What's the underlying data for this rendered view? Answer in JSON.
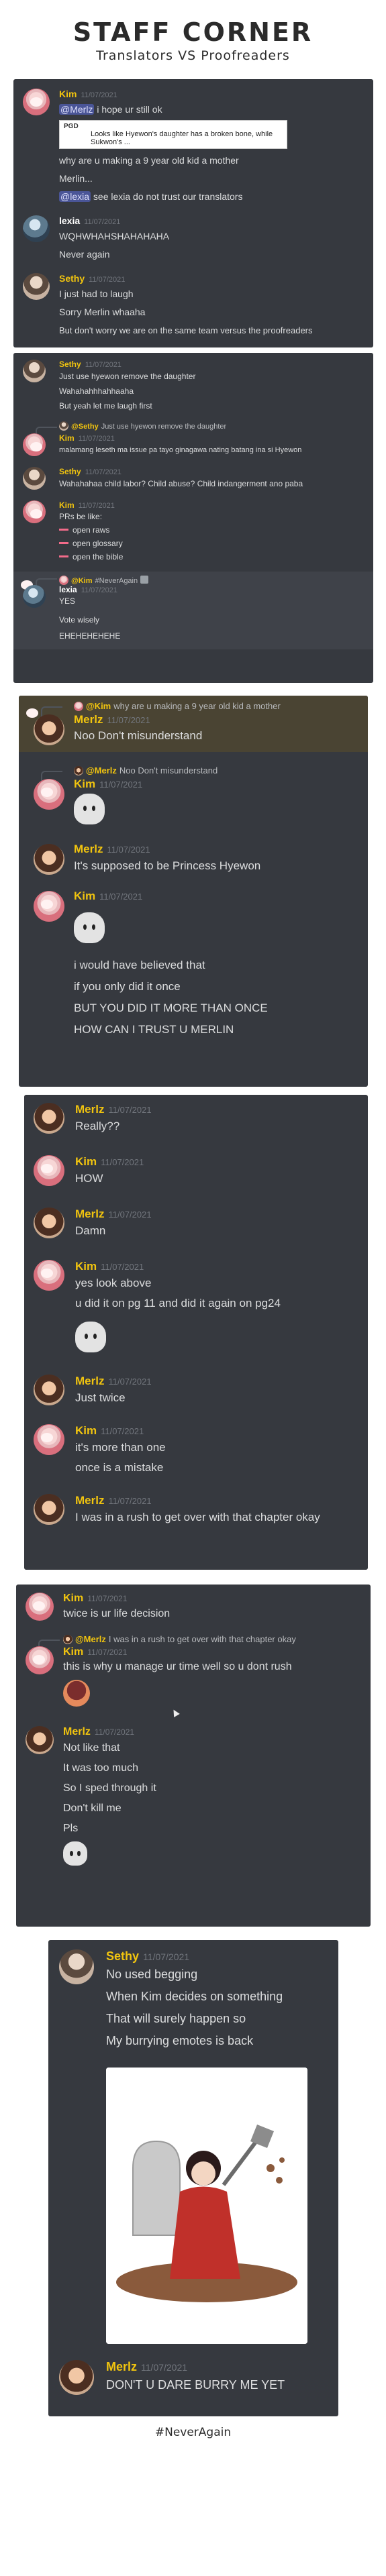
{
  "header": {
    "title": "STAFF CORNER",
    "subtitle": "Translators VS Proofreaders"
  },
  "users": {
    "kim": "Kim",
    "lexia": "lexia",
    "sethy": "Sethy",
    "merlz": "Merlz"
  },
  "panel1": {
    "m1": {
      "ts": "11/07/2021",
      "mention": "@Merlz",
      "l1": " i hope ur still ok",
      "embed_tag": "PGD",
      "embed_text": "Looks like Hyewon's daughter has a broken bone, while Sukwon's ...",
      "l2": "why are u making a 9 year old kid a mother",
      "l3": "Merlin...",
      "mention2": "@lexia",
      "l4": " see lexia do not trust our translators"
    },
    "m2": {
      "ts": "11/07/2021",
      "l1": "WQHWHAHSHAHAHAHA",
      "l2": "Never again"
    },
    "m3": {
      "ts": "11/07/2021",
      "l1": "I just had to laugh",
      "l2": "Sorry Merlin whaaha",
      "l3": "But don't worry we are on the same team versus the proofreaders"
    }
  },
  "panel2": {
    "m1": {
      "ts": "11/07/2021",
      "l1": "Just use hyewon remove the daughter",
      "l2": "Wahahahhhahhaaha",
      "l3": "But yeah let me laugh first"
    },
    "m2": {
      "reply_name": "@Sethy",
      "reply_text": "Just use hyewon remove the daughter",
      "ts": "11/07/2021",
      "l1": "malamang leseth ma issue pa tayo ginagawa nating batang ina si Hyewon"
    },
    "m3": {
      "ts": "11/07/2021",
      "l1": "Wahahahaa child labor? Child abuse? Child indangerment ano paba"
    },
    "m4": {
      "ts": "11/07/2021",
      "l1": "PRs be like:",
      "b1": "open raws",
      "b2": "open glossary",
      "b3": "open the bible"
    },
    "m5": {
      "reply_name": "@Kim",
      "reply_text": "#NeverAgain",
      "ts": "11/07/2021",
      "l1": "YES",
      "l2": "Vote wisely",
      "l3": "EHEHEHEHEHE"
    }
  },
  "panel3": {
    "r1": {
      "reply_name": "@Kim",
      "reply_text": "why are u making a 9 year old kid a mother"
    },
    "m1": {
      "ts": "11/07/2021",
      "l1": "Noo Don't misunderstand"
    },
    "r2": {
      "reply_name": "@Merlz",
      "reply_text": "Noo Don't misunderstand"
    },
    "m2": {
      "ts": "11/07/2021"
    },
    "m3": {
      "ts": "11/07/2021",
      "l1": "It's supposed to be Princess Hyewon"
    },
    "m4": {
      "ts": "11/07/2021",
      "l1": "i would have believed that",
      "l2": "if you only did it once",
      "l3": "BUT YOU DID IT MORE THAN ONCE",
      "l4": "HOW CAN I TRUST U MERLIN"
    }
  },
  "panel4": {
    "m1": {
      "ts": "11/07/2021",
      "l1": "Really??"
    },
    "m2": {
      "ts": "11/07/2021",
      "l1": "HOW"
    },
    "m3": {
      "ts": "11/07/2021",
      "l1": "Damn"
    },
    "m4": {
      "ts": "11/07/2021",
      "l1": "yes look above",
      "l2": "u did it on pg 11 and did it again on pg24"
    },
    "m5": {
      "ts": "11/07/2021",
      "l1": "Just twice"
    },
    "m6": {
      "ts": "11/07/2021",
      "l1": "it's more than one",
      "l2": "once is a mistake"
    },
    "m7": {
      "ts": "11/07/2021",
      "l1": "I was in a rush to get over with that chapter okay"
    }
  },
  "panel5": {
    "m1": {
      "ts": "11/07/2021",
      "l1": "twice is ur life decision"
    },
    "r1": {
      "reply_name": "@Merlz",
      "reply_text": "I was in a rush to get over with that chapter okay"
    },
    "m2": {
      "ts": "11/07/2021",
      "l1": "this is why u manage ur time well so u dont rush"
    },
    "m3": {
      "ts": "11/07/2021",
      "l1": "Not like that",
      "l2": "It was too much",
      "l3": "So I sped through it",
      "l4": "Don't kill me",
      "l5": "Pls"
    }
  },
  "panel6": {
    "m1": {
      "ts": "11/07/2021",
      "l1": "No used begging",
      "l2": "When Kim decides on something",
      "l3": "That will surely happen so",
      "l4": "My burrying emotes is back"
    },
    "m2": {
      "ts": "11/07/2021",
      "l1": "DON'T U DARE BURRY ME YET"
    }
  },
  "footer": {
    "hashtag": "#NeverAgain"
  }
}
